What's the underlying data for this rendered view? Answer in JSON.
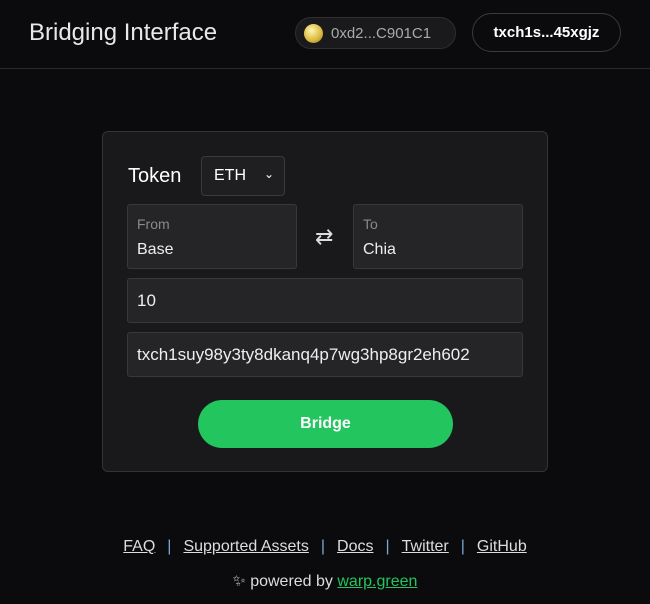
{
  "header": {
    "title": "Bridging Interface",
    "eth_wallet": "0xd2...C901C1",
    "xch_wallet": "txch1s...45xgjz"
  },
  "form": {
    "token_label": "Token",
    "token_value": "ETH",
    "from_label": "From",
    "from_value": "Base",
    "to_label": "To",
    "to_value": "Chia",
    "amount": "10",
    "address": "txch1suy98y3ty8dkanq4p7wg3hp8gr2eh602",
    "bridge_label": "Bridge"
  },
  "footer": {
    "links": [
      "FAQ",
      "Supported Assets",
      "Docs",
      "Twitter",
      "GitHub"
    ],
    "powered_by": "powered by",
    "brand": "warp.green"
  },
  "colors": {
    "accent": "#22c55e",
    "background": "#0b0b0d"
  }
}
